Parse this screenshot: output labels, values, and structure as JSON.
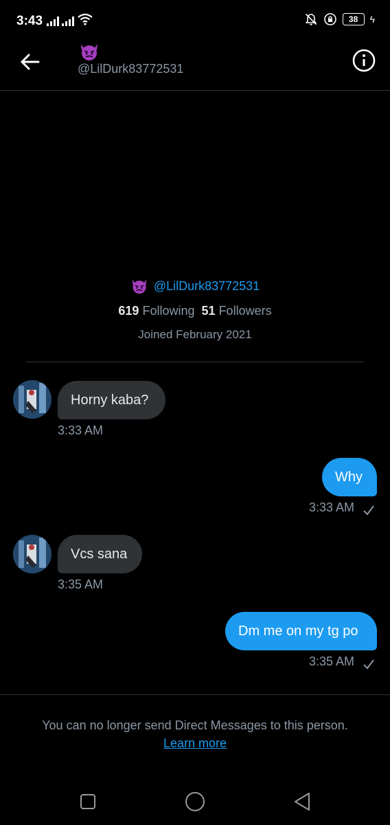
{
  "status_bar": {
    "time": "3:43",
    "battery": "38"
  },
  "header": {
    "handle": "@LilDurk83772531"
  },
  "profile": {
    "handle": "@LilDurk83772531",
    "following_count": "619",
    "following_label": "Following",
    "followers_count": "51",
    "followers_label": "Followers",
    "joined": "Joined February 2021"
  },
  "messages": [
    {
      "direction": "incoming",
      "text": "Horny kaba?",
      "time": "3:33 AM"
    },
    {
      "direction": "outgoing",
      "text": "Why",
      "time": "3:33 AM"
    },
    {
      "direction": "incoming",
      "text": "Vcs sana",
      "time": "3:35 AM"
    },
    {
      "direction": "outgoing",
      "text": "Dm me on my tg po",
      "time": "3:35 AM"
    }
  ],
  "footer": {
    "notice": "You can no longer send Direct Messages to this person.",
    "learn_more": "Learn more"
  },
  "colors": {
    "accent": "#1d9bf0",
    "incoming_bubble": "#2f3336",
    "background": "#000000"
  },
  "icons": [
    "back-arrow-icon",
    "info-icon",
    "devil-emoji-icon",
    "read-check-icon",
    "square-nav-icon",
    "circle-nav-icon",
    "triangle-back-nav-icon"
  ]
}
